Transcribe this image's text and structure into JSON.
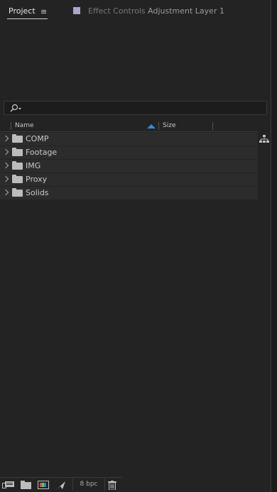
{
  "tabs": {
    "project_label": "Project",
    "effect_controls_label": "Effect Controls",
    "effect_controls_layer": "Adjustment Layer 1"
  },
  "search": {
    "placeholder": "",
    "value": ""
  },
  "columns": {
    "name": "Name",
    "size": "Size"
  },
  "items": [
    {
      "label": "COMP"
    },
    {
      "label": "Footage"
    },
    {
      "label": "IMG"
    },
    {
      "label": "Proxy"
    },
    {
      "label": "Solids"
    }
  ],
  "toolbar": {
    "bpc_label": "8 bpc"
  },
  "colors": {
    "accent": "#2d8ceb",
    "background": "#232323",
    "swatch": "#a9a6c6"
  },
  "icons": [
    "menu-icon",
    "search-icon",
    "sort-ascending-icon",
    "flowchart-icon",
    "folder-icon",
    "interpret-footage-icon",
    "new-folder-icon",
    "new-composition-icon",
    "render-queue-icon",
    "trash-icon"
  ]
}
